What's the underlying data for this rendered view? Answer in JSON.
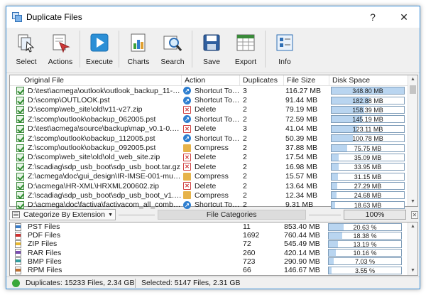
{
  "window": {
    "title": "Duplicate Files",
    "help_glyph": "?",
    "close_glyph": "✕"
  },
  "toolbar": [
    {
      "label": "Select",
      "icon": "select-icon"
    },
    {
      "label": "Actions",
      "icon": "actions-icon"
    },
    {
      "label": "Execute",
      "icon": "execute-icon"
    },
    {
      "label": "Charts",
      "icon": "charts-icon"
    },
    {
      "label": "Search",
      "icon": "search-icon"
    },
    {
      "label": "Save",
      "icon": "save-icon"
    },
    {
      "label": "Export",
      "icon": "export-icon"
    },
    {
      "label": "Info",
      "icon": "info-icon"
    }
  ],
  "table": {
    "columns": [
      "Original File",
      "Action",
      "Duplicates",
      "File Size",
      "Disk Space"
    ],
    "rows": [
      {
        "file": "D:\\test\\acmega\\outlook\\outlook_backup_11-Jan-...",
        "action": "Shortcut To:...",
        "type": "shortcut",
        "dups": "3",
        "size": "116.27 MB",
        "disk": "348.80 MB",
        "pct": 100
      },
      {
        "file": "D:\\scomp\\OUTLOOK.pst",
        "action": "Shortcut To:...",
        "type": "shortcut",
        "dups": "2",
        "size": "91.44 MB",
        "disk": "182.88 MB",
        "pct": 52
      },
      {
        "file": "D:\\scomp\\web_site\\old\\v11-v27.zip",
        "action": "Delete",
        "type": "delete",
        "dups": "2",
        "size": "79.19 MB",
        "disk": "158.39 MB",
        "pct": 45
      },
      {
        "file": "Z:\\scomp\\outlook\\obackup_062005.pst",
        "action": "Shortcut To:...",
        "type": "shortcut",
        "dups": "2",
        "size": "72.59 MB",
        "disk": "145.19 MB",
        "pct": 42
      },
      {
        "file": "D:\\test\\acmega\\source\\backup\\map_v0.1-0.9.zip",
        "action": "Delete",
        "type": "delete",
        "dups": "3",
        "size": "41.04 MB",
        "disk": "123.11 MB",
        "pct": 35
      },
      {
        "file": "Z:\\scomp\\outlook\\obackup_112005.pst",
        "action": "Shortcut To:...",
        "type": "shortcut",
        "dups": "2",
        "size": "50.39 MB",
        "disk": "100.78 MB",
        "pct": 29
      },
      {
        "file": "Z:\\scomp\\outlook\\obackup_092005.pst",
        "action": "Compress",
        "type": "compress",
        "dups": "2",
        "size": "37.88 MB",
        "disk": "75.75 MB",
        "pct": 22
      },
      {
        "file": "D:\\scomp\\web_site\\old\\old_web_site.zip",
        "action": "Delete",
        "type": "delete",
        "dups": "2",
        "size": "17.54 MB",
        "disk": "35.09 MB",
        "pct": 10
      },
      {
        "file": "Z:\\scadiag\\sdp_usb_boot\\sdp_usb_boot.tar.gz",
        "action": "Delete",
        "type": "delete",
        "dups": "2",
        "size": "16.98 MB",
        "disk": "33.95 MB",
        "pct": 10
      },
      {
        "file": "Z:\\acmega\\doc\\gui_design\\IR-IMSE-001-museum...",
        "action": "Compress",
        "type": "compress",
        "dups": "2",
        "size": "15.57 MB",
        "disk": "31.15 MB",
        "pct": 9
      },
      {
        "file": "D:\\acmega\\HR-XML\\HRXML200602.zip",
        "action": "Delete",
        "type": "delete",
        "dups": "2",
        "size": "13.64 MB",
        "disk": "27.29 MB",
        "pct": 8
      },
      {
        "file": "Z:\\scadiag\\sdp_usb_boot\\sdp_usb_boot_v1.50.39.t...",
        "action": "Compress",
        "type": "compress",
        "dups": "2",
        "size": "12.34 MB",
        "disk": "24.68 MB",
        "pct": 7
      },
      {
        "file": "D:\\acmega\\doc\\factiva\\factivacom_all_combined....",
        "action": "Shortcut To:...",
        "type": "shortcut",
        "dups": "2",
        "size": "9.31 MB",
        "disk": "18.63 MB",
        "pct": 5
      }
    ]
  },
  "categorize": {
    "selected": "Categorize By Extension",
    "label": "File Categories",
    "percent": "100%",
    "rows": [
      {
        "name": "PST Files",
        "count": "11",
        "size": "853.40 MB",
        "pct_text": "20.63 %",
        "pct": 20.63,
        "color": "#3a7dc9"
      },
      {
        "name": "PDF Files",
        "count": "1692",
        "size": "760.44 MB",
        "pct_text": "18.38 %",
        "pct": 18.38,
        "color": "#d03030"
      },
      {
        "name": "ZIP Files",
        "count": "72",
        "size": "545.49 MB",
        "pct_text": "13.19 %",
        "pct": 13.19,
        "color": "#e8b830"
      },
      {
        "name": "RAR Files",
        "count": "260",
        "size": "420.14 MB",
        "pct_text": "10.16 %",
        "pct": 10.16,
        "color": "#7a4fb0"
      },
      {
        "name": "BMP Files",
        "count": "723",
        "size": "290.90 MB",
        "pct_text": "7.03 %",
        "pct": 7.03,
        "color": "#2f9f9f"
      },
      {
        "name": "RPM Files",
        "count": "66",
        "size": "146.67 MB",
        "pct_text": "3.55 %",
        "pct": 3.55,
        "color": "#c07030"
      }
    ]
  },
  "status": {
    "duplicates": "Duplicates: 15233 Files, 2.34 GB",
    "selected": "Selected: 5147 Files, 2.31 GB"
  }
}
